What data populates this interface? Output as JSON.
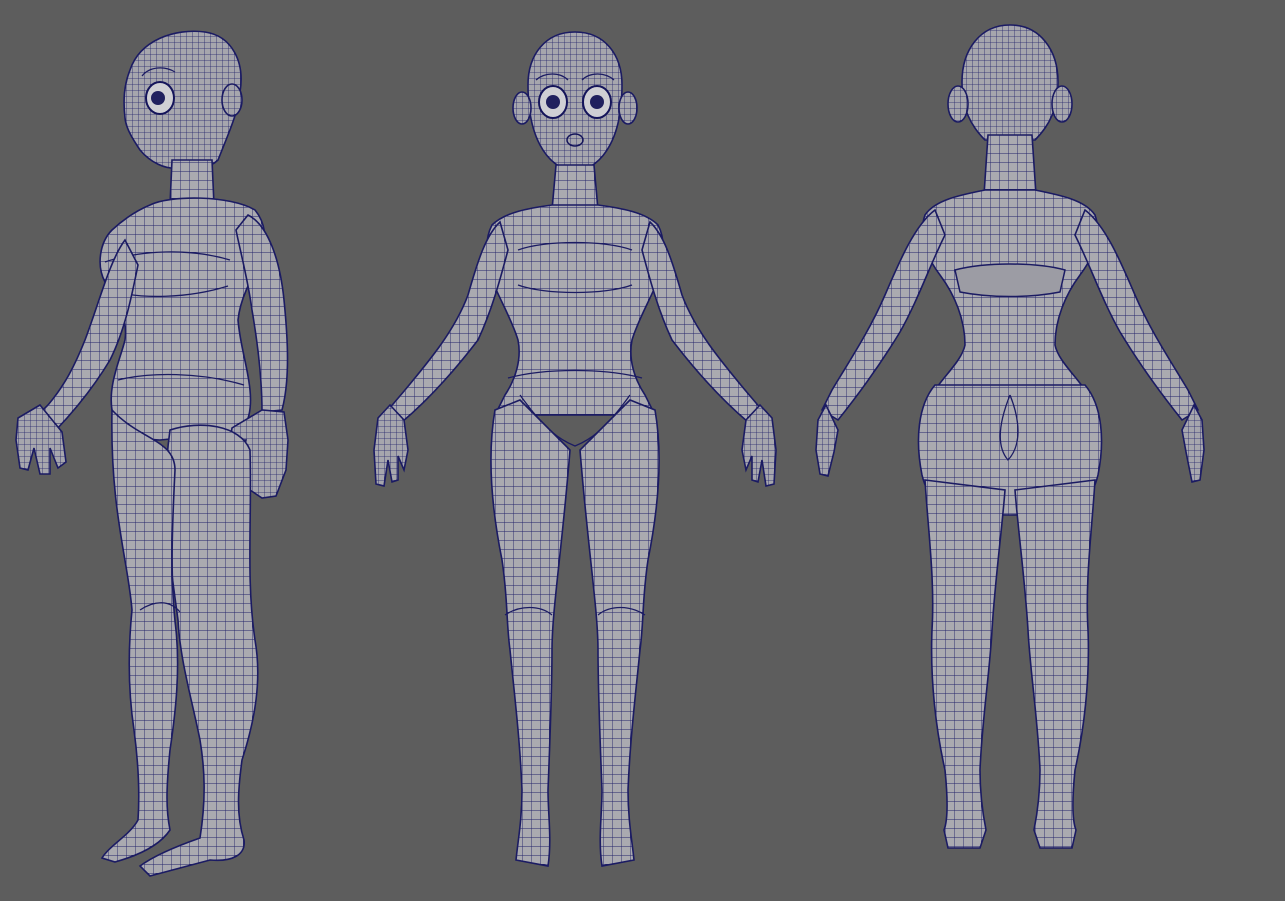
{
  "scene": {
    "background_color": "#5d5d5d",
    "mesh_fill_color": "#a9a9af",
    "wire_color": "#1b1b63"
  },
  "views": [
    {
      "view": "three-quarter"
    },
    {
      "view": "front"
    },
    {
      "view": "back"
    }
  ]
}
